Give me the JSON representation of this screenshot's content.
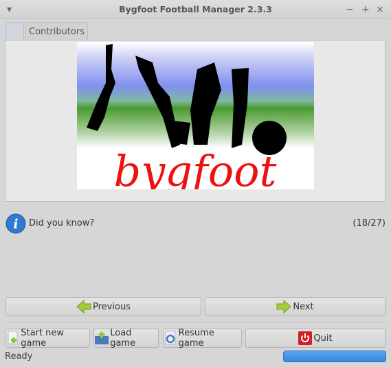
{
  "window": {
    "title": "Bygfoot Football Manager 2.3.3",
    "minimize": "−",
    "maximize": "+",
    "close": "×",
    "menu": "▾"
  },
  "tabs": [
    {
      "label": ""
    },
    {
      "label": "Contributors"
    }
  ],
  "logo": {
    "text": "bygfoot",
    "color": "#ee1111"
  },
  "tip": {
    "label": "Did you know?",
    "counter": "(18/27)"
  },
  "nav": {
    "previous": "Previous",
    "next": "Next"
  },
  "actions": {
    "start": "Start new game",
    "load": "Load game",
    "resume": "Resume game",
    "quit": "Quit"
  },
  "status": {
    "text": "Ready",
    "progress_percent": 100,
    "progress_color": "#3c8ee0"
  }
}
